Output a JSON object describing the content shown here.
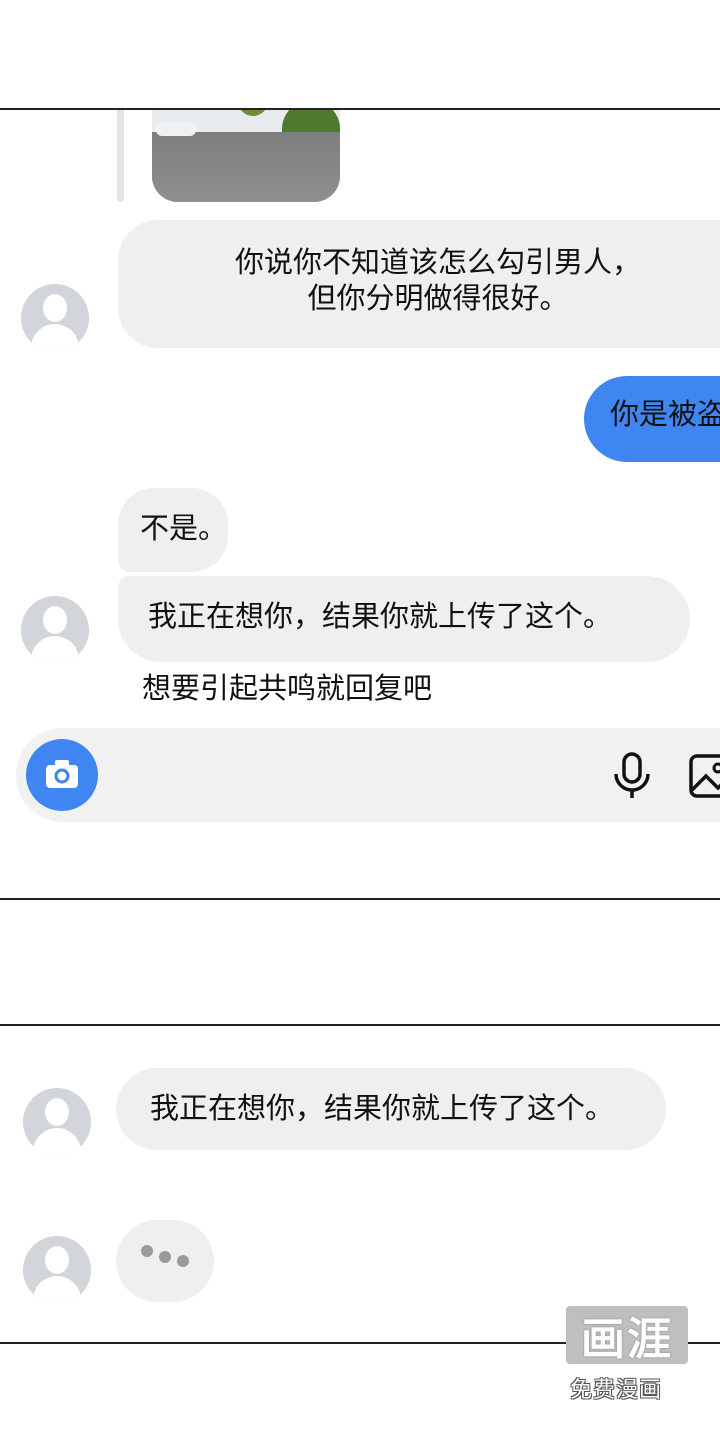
{
  "panel1": {
    "messages": [
      {
        "side": "in",
        "lines": [
          "你说你不知道该怎么勾引男人，",
          "但你分明做得很好。"
        ]
      },
      {
        "side": "out",
        "text": "你是被盗"
      },
      {
        "side": "in",
        "text": "不是。"
      },
      {
        "side": "in",
        "text": "我正在想你，结果你就上传了这个。"
      }
    ],
    "reply_hint": "想要引起共鸣就回复吧"
  },
  "panel2": {
    "message": "我正在想你，结果你就上传了这个。",
    "typing": "•••"
  },
  "composer": {
    "camera_icon": "camera-icon",
    "mic_icon": "microphone-icon",
    "gallery_icon": "image-icon"
  },
  "watermark": {
    "logo": "画涯",
    "text": "免费漫画"
  },
  "colors": {
    "outgoing": "#3f86f3",
    "incoming": "#efefef"
  }
}
